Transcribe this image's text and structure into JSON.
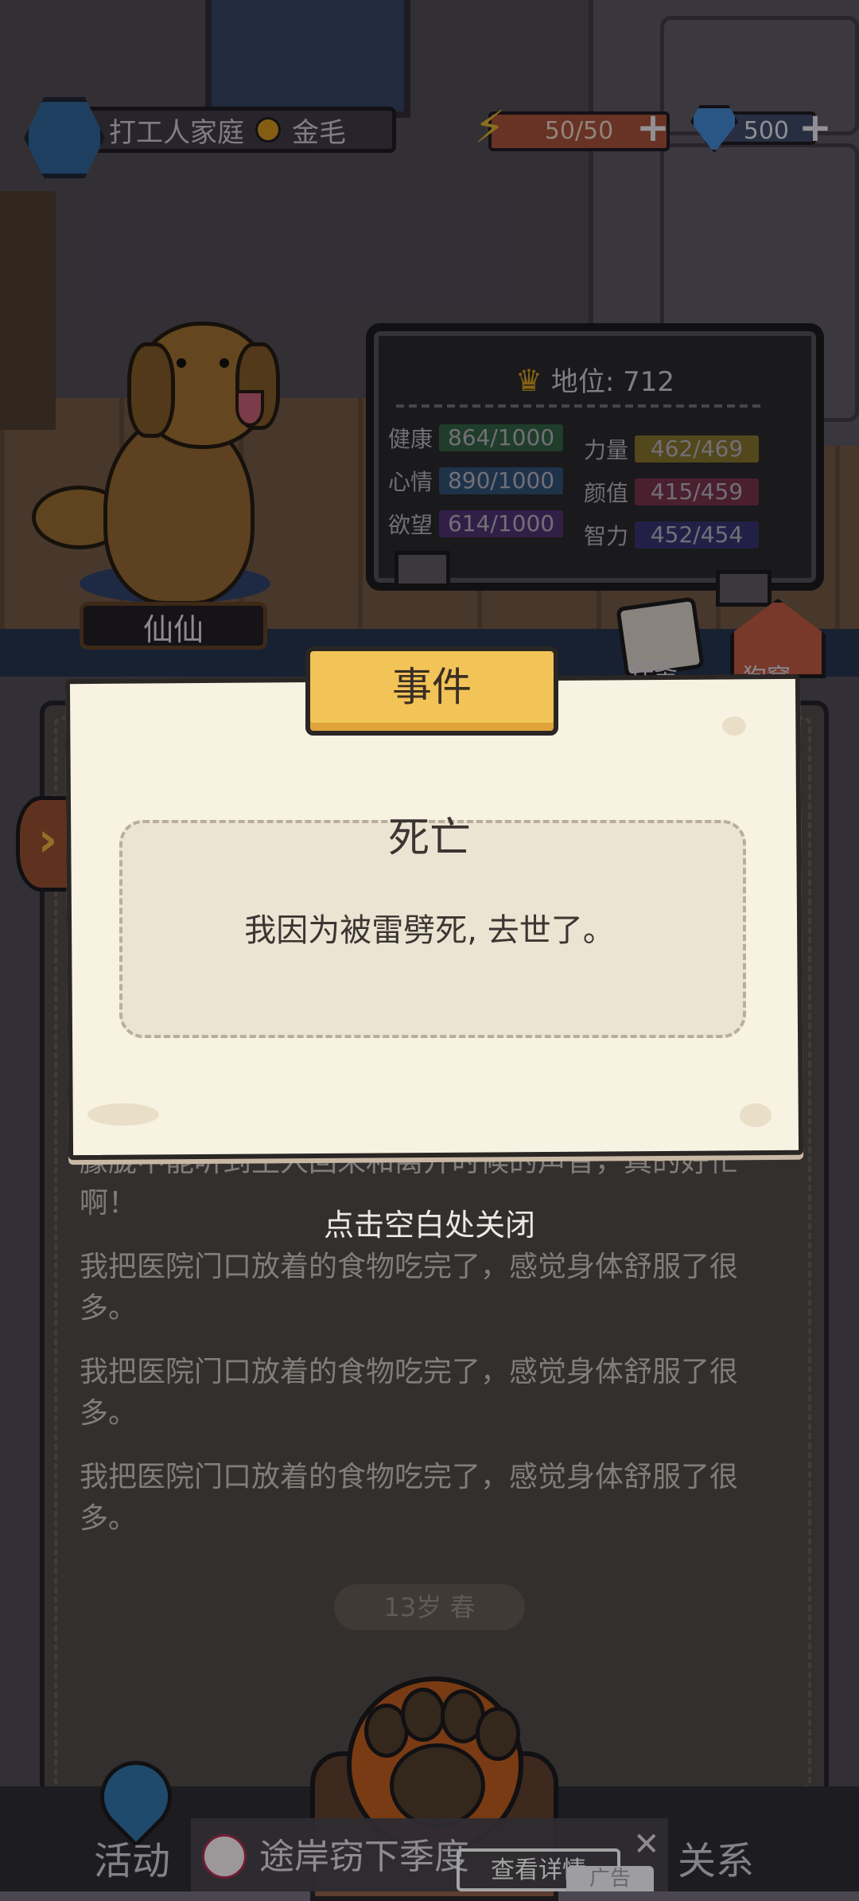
{
  "hud": {
    "family": "打工人家庭",
    "breed": "金毛",
    "energy": "50/50",
    "gems": "500"
  },
  "pet": {
    "name": "仙仙"
  },
  "status": {
    "title": "地位: 712",
    "stats": [
      {
        "label": "健康",
        "value": "864/1000",
        "color": "#2f5a3e"
      },
      {
        "label": "力量",
        "value": "462/469",
        "color": "#7a6a2a"
      },
      {
        "label": "心情",
        "value": "890/1000",
        "color": "#2d4c6e"
      },
      {
        "label": "颜值",
        "value": "415/459",
        "color": "#6e2f44"
      },
      {
        "label": "欲望",
        "value": "614/1000",
        "color": "#4a2f6a"
      },
      {
        "label": "智力",
        "value": "452/454",
        "color": "#34306a"
      }
    ]
  },
  "side_icons": {
    "task": "任务",
    "kennel": "狗窝"
  },
  "log": {
    "lines": [
      "朦胧中能听到主人回来和离开时候的声音，真的好忙啊！",
      "我把医院门口放着的食物吃完了，感觉身体舒服了很多。",
      "我把医院门口放着的食物吃完了，感觉身体舒服了很多。",
      "我把医院门口放着的食物吃完了，感觉身体舒服了很多。"
    ],
    "season": "13岁 春"
  },
  "modal": {
    "tab": "事件",
    "heading": "死亡",
    "message": "我因为被雷劈死, 去世了。",
    "close_hint": "点击空白处关闭"
  },
  "nav": {
    "left": "活动",
    "right": "关系"
  },
  "ad": {
    "title": "下季度",
    "title_prefix": "途岸窃",
    "button": "查看详情",
    "tag": "广告",
    "close": "✕"
  }
}
